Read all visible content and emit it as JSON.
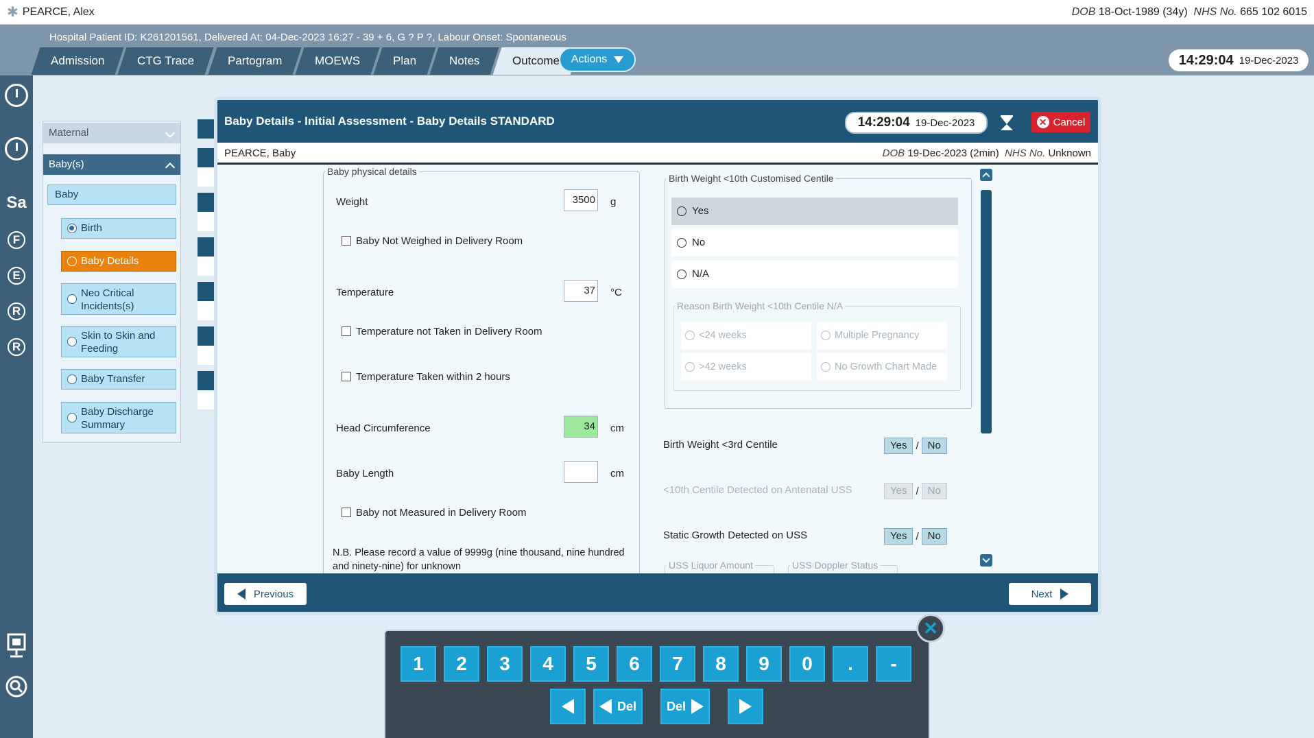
{
  "patient": {
    "name": "PEARCE, Alex",
    "dob_label": "DOB",
    "dob": "18-Oct-1989 (34y)",
    "nhs_label": "NHS No.",
    "nhs": "665 102 6015",
    "hospital_info": "Hospital Patient ID: K261201561, Delivered At: 04-Dec-2023 16:27 - 39 + 6, G ? P ?,   Labour Onset: Spontaneous"
  },
  "tabs": [
    {
      "label": "Admission"
    },
    {
      "label": "CTG Trace"
    },
    {
      "label": "Partogram"
    },
    {
      "label": "MOEWS"
    },
    {
      "label": "Plan"
    },
    {
      "label": "Notes"
    },
    {
      "label": "Outcome"
    }
  ],
  "actions_label": "Actions",
  "clock": {
    "time": "14:29:04",
    "date": "19-Dec-2023"
  },
  "strip_icons": {
    "sa": "Sa",
    "f": "F",
    "e": "E",
    "r1": "R",
    "r2": "R"
  },
  "leftnav": {
    "maternal": "Maternal",
    "babies": "Baby(s)",
    "baby": "Baby",
    "items": [
      {
        "label": "Birth"
      },
      {
        "label": "Baby Details"
      },
      {
        "label": "Neo Critical Incidents(s)"
      },
      {
        "label": "Skin to Skin and Feeding"
      },
      {
        "label": "Baby Transfer"
      },
      {
        "label": "Baby Discharge Summary"
      }
    ]
  },
  "dialog": {
    "title": "Baby Details - Initial Assessment - Baby Details STANDARD",
    "time": "14:29:04",
    "date": "19-Dec-2023",
    "cancel": "Cancel",
    "baby_name": "PEARCE, Baby",
    "dob_label": "DOB",
    "dob": "19-Dec-2023 (2min)",
    "nhs_label": "NHS No.",
    "nhs": "Unknown",
    "physical": {
      "legend": "Baby physical details",
      "weight_label": "Weight",
      "weight": "3500",
      "weight_unit": "g",
      "not_weighed": "Baby Not Weighed in Delivery Room",
      "temp_label": "Temperature",
      "temp": "37",
      "temp_unit": "°C",
      "temp_not_taken": "Temperature not Taken in Delivery Room",
      "temp_2h": "Temperature Taken within 2 hours",
      "head_label": "Head Circumference",
      "head": "34",
      "head_unit": "cm",
      "length_label": "Baby Length",
      "length": "",
      "length_unit": "cm",
      "not_measured": "Baby not Measured in Delivery Room",
      "note": "N.B. Please record a value of 9999g (nine thousand, nine hundred and ninety-nine) for unknown"
    },
    "centile": {
      "legend": "Birth Weight <10th Customised Centile",
      "yes": "Yes",
      "no": "No",
      "na": "N/A",
      "reason_legend": "Reason Birth Weight <10th Centile N/A",
      "r1": "<24 weeks",
      "r2": "Multiple Pregnancy",
      "r3": ">42 weeks",
      "r4": "No Growth Chart Made"
    },
    "bw3_label": "Birth Weight <3rd Centile",
    "uss10_label": "<10th Centile Detected on Antenatal USS",
    "static_label": "Static Growth Detected on USS",
    "yes": "Yes",
    "no": "No",
    "slash": "/",
    "liquor_legend": "USS Liquor Amount",
    "doppler_legend": "USS Doppler Status",
    "previous": "Previous",
    "next": "Next"
  },
  "keypad": {
    "keys": [
      "1",
      "2",
      "3",
      "4",
      "5",
      "6",
      "7",
      "8",
      "9",
      "0",
      ".",
      "-"
    ],
    "del": "Del",
    "close": "✕"
  }
}
